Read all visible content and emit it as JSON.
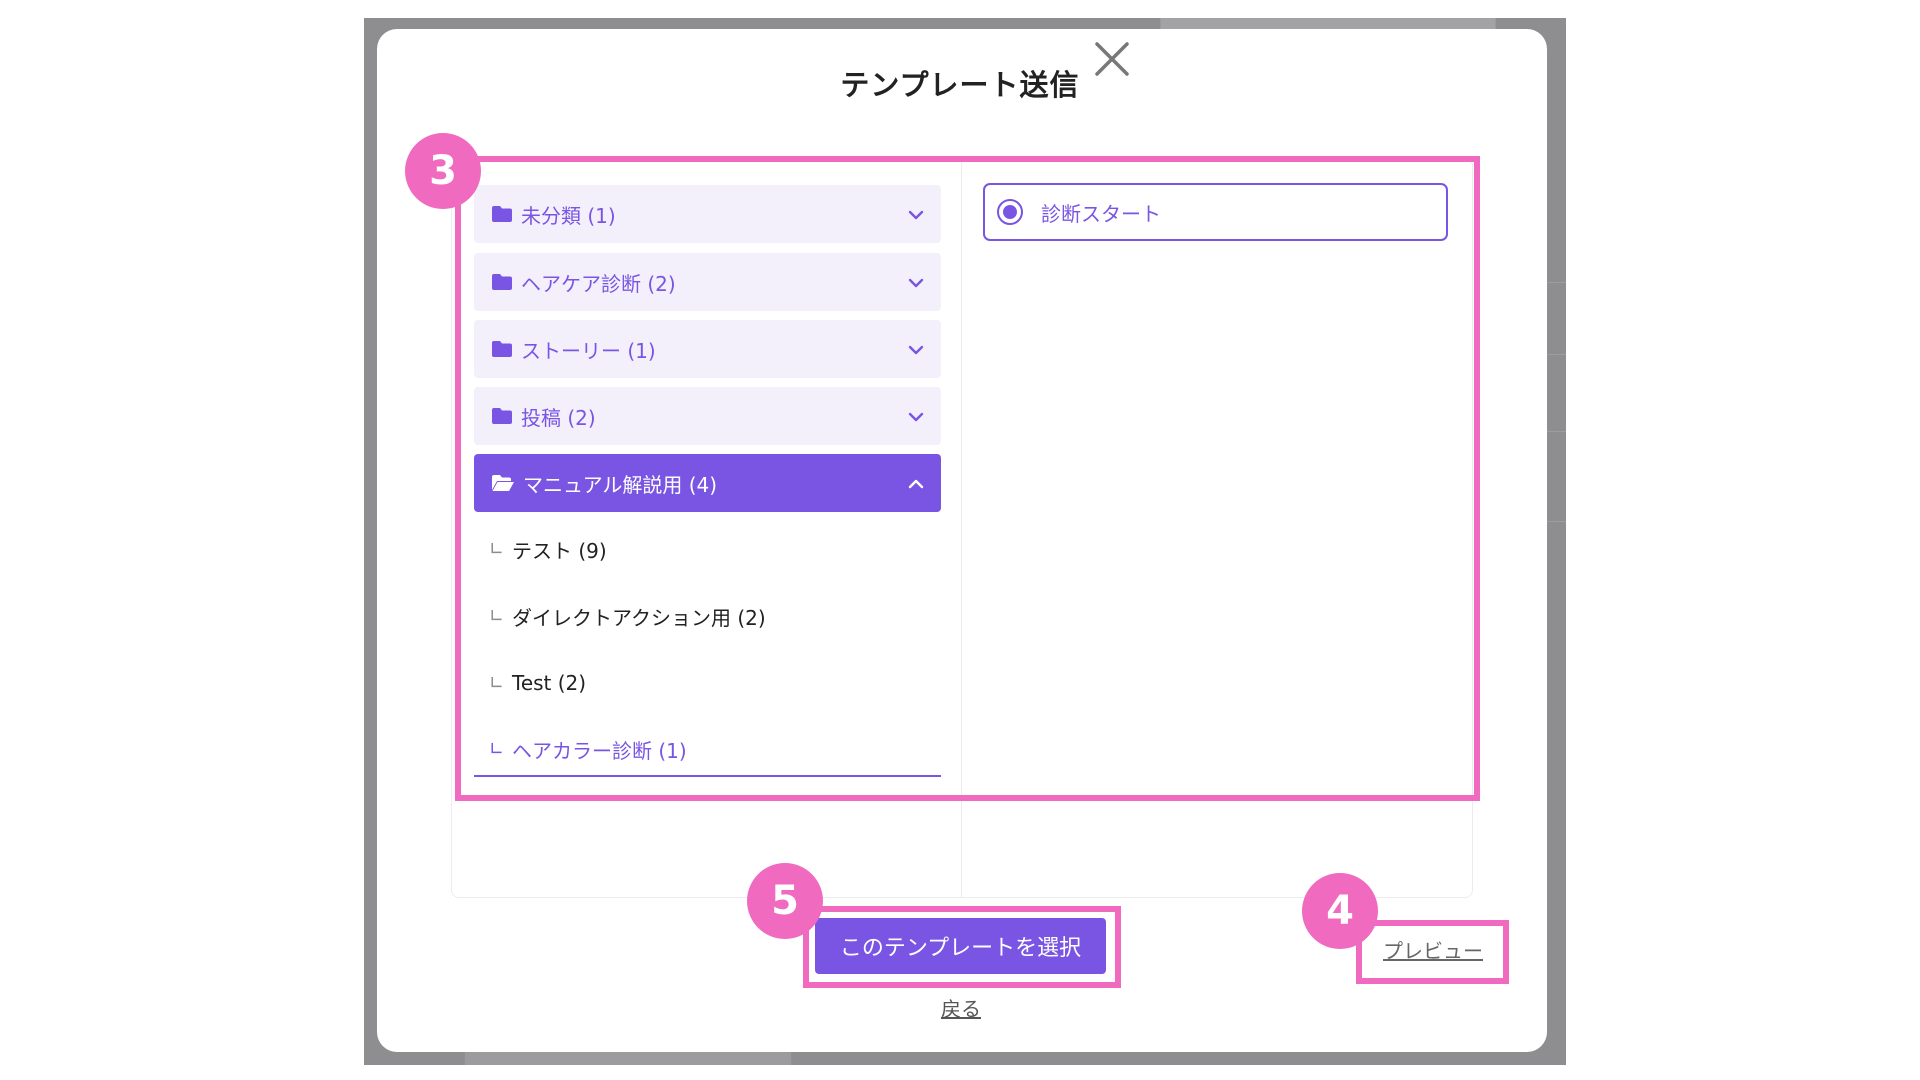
{
  "dialog": {
    "title": "テンプレート送信",
    "close_icon": "close-icon"
  },
  "folders": [
    {
      "label": "未分類 (1)",
      "icon": "folder-icon",
      "expanded": false
    },
    {
      "label": "ヘアケア診断 (2)",
      "icon": "folder-icon",
      "expanded": false
    },
    {
      "label": "ストーリー (1)",
      "icon": "folder-icon",
      "expanded": false
    },
    {
      "label": "投稿 (2)",
      "icon": "folder-icon",
      "expanded": false
    },
    {
      "label": "マニュアル解説用 (4)",
      "icon": "folder-open-icon",
      "expanded": true
    }
  ],
  "subfolders": {
    "branch": "∟",
    "items": [
      {
        "label": "テスト (9)"
      },
      {
        "label": "ダイレクトアクション用 (2)"
      },
      {
        "label": "Test (2)"
      },
      {
        "label": "ヘアカラー診断 (1)",
        "active": true
      }
    ]
  },
  "templates": {
    "items": [
      {
        "label": "診断スタート",
        "selected": true
      }
    ]
  },
  "actions": {
    "select_label": "このテンプレートを選択",
    "back_label": "戻る",
    "preview_label": "プレビュー"
  },
  "callouts": {
    "list_area": "3",
    "preview": "4",
    "select": "5"
  },
  "colors": {
    "accent": "#7a55e3",
    "folder_bg": "#f3f0fc",
    "highlight": "#f06bbf",
    "backdrop": "#8e8e90"
  }
}
